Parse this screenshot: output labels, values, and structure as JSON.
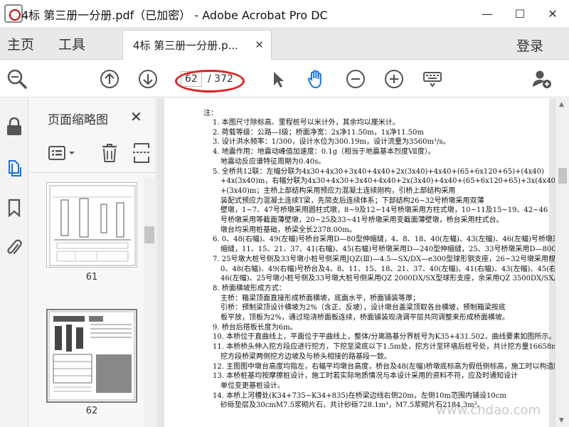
{
  "window": {
    "title": "4标 第三册一分册.pdf（已加密） - Adobe Acrobat Pro DC",
    "minimize": "—",
    "maximize": "☐",
    "close": "✕"
  },
  "tabbar": {
    "home": "主页",
    "tools": "工具",
    "doc_tab": "4标 第三册一分册.p...",
    "doc_tab_close": "✕",
    "login": "登录"
  },
  "toolbar": {
    "page_current": "62",
    "page_total": "/ 372"
  },
  "thumbnails": {
    "title": "页面缩略图",
    "close": "✕",
    "pages": [
      {
        "label": "61"
      },
      {
        "label": "62"
      }
    ]
  },
  "document": {
    "heading": "注：",
    "notes": [
      "1. 本图尺寸除标高、里程桩号以米计外，其余均以厘米计。",
      "2. 荷载等级：公路—Ⅰ级；桥面净宽：2x净11.50m，1x净11.50m",
      "3. 设计洪水频率：1/300，设计水位为300.19m，设计流量为3560m³/s。",
      "4. 地震作用：地震动峰值加速度：0.1g（相当于地震基本烈度Ⅶ度）。",
      "地震动反应谱特征周期为0.40s。",
      "5. 全桥共12联：左幅分联为4x30+4x30+3x40+4x40+2x(3x40)+4x40+(65+6x120+65)+(4x40)",
      "+4x(3x40)m，右幅分联为4x30+4x30+3x40+4x40+2x(3x40)+4x40+(65+6x120+65)+3x(4x40)",
      "+(3x40)m；主桥上部结构采用预应力混凝土连续刚构，引桥上部结构采用",
      "装配式预应力混凝土连续T梁，先简支后连续体系；下部结构26~32号桥墩采用双薄",
      "壁墩，1~7、47号桥墩采用圆柱式墩，8~9及12~14号桥墩采用方柱式墩，10~11及15~19、42~46",
      "号桥墩采用等截面薄壁墩，20~25及33~41号桥墩采用变截面薄壁墩，桥台采用柱式台。",
      "墩台均采用桩基础，桥梁全长2378.00m。",
      "6. 0、48(右幅)、49(左幅)号桥台采用D—80型伸缩缝，4、8、18、40(左幅)、43(左幅)、46(左幅)号桥墩采用D—160型",
      "缩缝，11、15、21、37、41(右幅)、45(右幅)号桥墩采用D—240型伸缩缝，25、33号桥墩采用D—800型伸缩缝。",
      "7. 25号墩大桩号侧及33号墩小桩号侧采用JQZ(Ⅲ)—4.5—SX/DX—e300型球形钢支座，26~32号墩采用规格圆柱，",
      "0、48(右幅)、49(右幅)号桥台及4、8、11、15、18、21、37、40(左幅)、41(右幅)、43(左幅)、45(右幅)、",
      "46(左幅)、25号墩小桩号侧及33号墩大桩号侧采用QZ 2000DX/SX型球形支座，余采用QZ 3500DX/SX/GD型球形",
      "8. 桥面横坡形成方式：",
      "主桥：箱梁顶面直接形成桥面横坡，底面水平，桥面铺装等厚；",
      "引桥：预制梁顶设计横坡为2%（含正、反坡），设计墩台盖梁顶取各台横坡，预制箱梁按底",
      "板平放，顶板为2%，通过现浇桥面板连续，桥面铺装现浇调平层共同调整来形成桥面横坡。",
      "9. 桥台后搭板长度为6m。",
      "10. 本桥位于直曲线上，平面位于平曲线上，整体/分离路基分界桩号为K35+431.502，曲线要素如图所示。",
      "11. 本桥桥头伸入挖方段应进行挖方，下挖至梁底以下1.5m处，挖方计至环墙后桩号处，共计挖方量16658m³；",
      "挖方段桥梁两侧挖方边坡及与桥头相接的路基段一致。",
      "12. 主图图中墩台高度均指左，右幅平均墩台高度，桥台及48(左幅)桥墩底标高为假低侧标高，施工时以构造图为准。",
      "13. 本桥桩基均按摩擦桩设计，施工时若实际地质情况与本设计采用的资料不符，应及时通知设计",
      "单位变更基桩设计。",
      "14. 本桥上河槽处(K34+735~K34+835)在桥梁边线右侧20m，左侧10m范围内铺设10cm",
      "砂砾垫层及30cmM7.5浆砌片石，共计砂砾728.1m³，M7.5浆砌片石2184.3m³。"
    ],
    "watermark": "www.cndao.com"
  },
  "icons": {
    "tools": [
      "zoom-tool-icon",
      "page-up-icon",
      "page-down-icon",
      "select-cursor-icon",
      "hand-tool-icon",
      "zoom-out-icon",
      "zoom-in-icon",
      "keyboard-tool-icon",
      "add-user-icon"
    ],
    "rail": [
      "lock-icon",
      "pages-icon",
      "bookmark-icon",
      "attachment-icon"
    ],
    "thumbs": [
      "page-options-icon",
      "delete-icon",
      "crop-icon"
    ]
  },
  "colors": {
    "accent_blue": "#1473e6",
    "annotation_red": "#dd2222"
  }
}
